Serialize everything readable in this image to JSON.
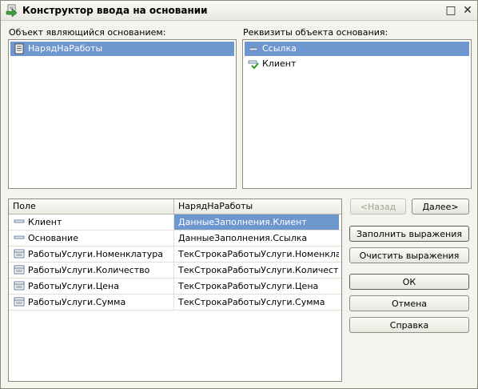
{
  "window": {
    "title": "Конструктор ввода на основании",
    "minimize_glyph": "□",
    "close_glyph": "✕"
  },
  "basis_object": {
    "label": "Объект являющийся основанием:",
    "items": [
      {
        "label": "НарядНаРаботы",
        "icon": "document-icon",
        "selected": true
      }
    ]
  },
  "basis_attributes": {
    "label": "Реквизиты объекта основания:",
    "items": [
      {
        "label": "Ссылка",
        "icon": "attribute-dash-icon",
        "selected": true
      },
      {
        "label": "Клиент",
        "icon": "attribute-green-check-icon",
        "selected": false
      }
    ]
  },
  "grid": {
    "columns": [
      "Поле",
      "НарядНаРаботы"
    ],
    "rows": [
      {
        "field": "Клиент",
        "icon": "attribute-dash-icon",
        "value": "ДанныеЗаполнения.Клиент",
        "selected": true
      },
      {
        "field": "Основание",
        "icon": "attribute-dash-icon",
        "value": "ДанныеЗаполнения.Ссылка",
        "selected": false
      },
      {
        "field": "РаботыУслуги.Номенклатура",
        "icon": "table-field-icon",
        "value": "ТекСтрокаРаботыУслуги.Номенклат...",
        "selected": false
      },
      {
        "field": "РаботыУслуги.Количество",
        "icon": "table-field-icon",
        "value": "ТекСтрокаРаботыУслуги.Количество",
        "selected": false
      },
      {
        "field": "РаботыУслуги.Цена",
        "icon": "table-field-icon",
        "value": "ТекСтрокаРаботыУслуги.Цена",
        "selected": false
      },
      {
        "field": "РаботыУслуги.Сумма",
        "icon": "table-field-icon",
        "value": "ТекСтрокаРаботыУслуги.Сумма",
        "selected": false
      }
    ]
  },
  "buttons": {
    "back": "<Назад",
    "next": "Далее>",
    "fill_expressions": "Заполнить выражения",
    "clear_expressions": "Очистить выражения",
    "ok": "ОК",
    "cancel": "Отмена",
    "help": "Справка"
  },
  "colors": {
    "selection": "#6e97cf",
    "window_bg": "#f4f3ee"
  }
}
